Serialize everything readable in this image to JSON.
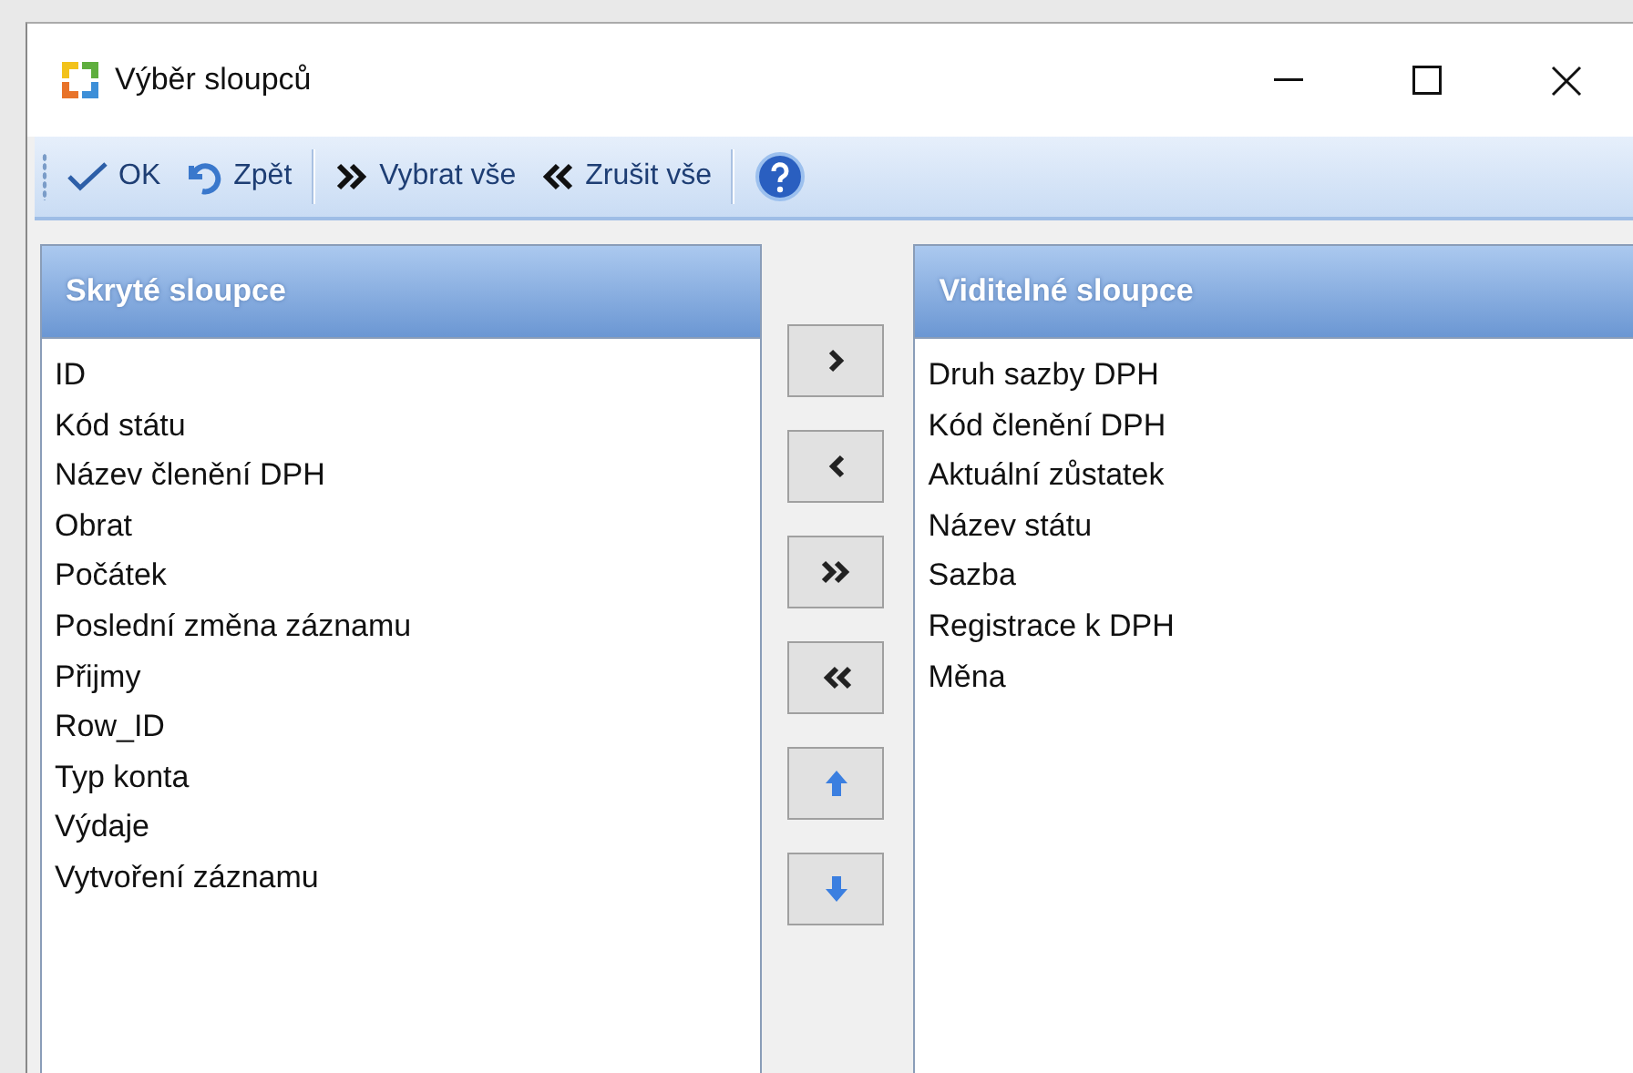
{
  "window": {
    "title": "Výběr sloupců"
  },
  "toolbar": [
    {
      "kind": "ok",
      "label": "OK"
    },
    {
      "kind": "undo",
      "label": "Zpět"
    },
    {
      "kind": "separator"
    },
    {
      "kind": "select-all",
      "label": "Vybrat vše"
    },
    {
      "kind": "clear-all",
      "label": "Zrušit vše"
    },
    {
      "kind": "separator"
    },
    {
      "kind": "help"
    }
  ],
  "hidden_columns": {
    "header": "Skryté sloupce",
    "items": [
      "ID",
      "Kód státu",
      "Název členění DPH",
      "Obrat",
      "Počátek",
      "Poslední změna záznamu",
      "Přijmy",
      "Row_ID",
      "Typ konta",
      "Výdaje",
      "Vytvoření záznamu"
    ]
  },
  "move_buttons": [
    {
      "kind": "add"
    },
    {
      "kind": "remove"
    },
    {
      "kind": "add-all"
    },
    {
      "kind": "remove-all"
    },
    {
      "kind": "up"
    },
    {
      "kind": "down"
    }
  ],
  "visible_columns": {
    "header": "Viditelné sloupce",
    "items": [
      "Druh sazby DPH",
      "Kód členění DPH",
      "Aktuální zůstatek",
      "Název státu",
      "Sazba",
      "Registrace k DPH",
      "Měna"
    ]
  }
}
